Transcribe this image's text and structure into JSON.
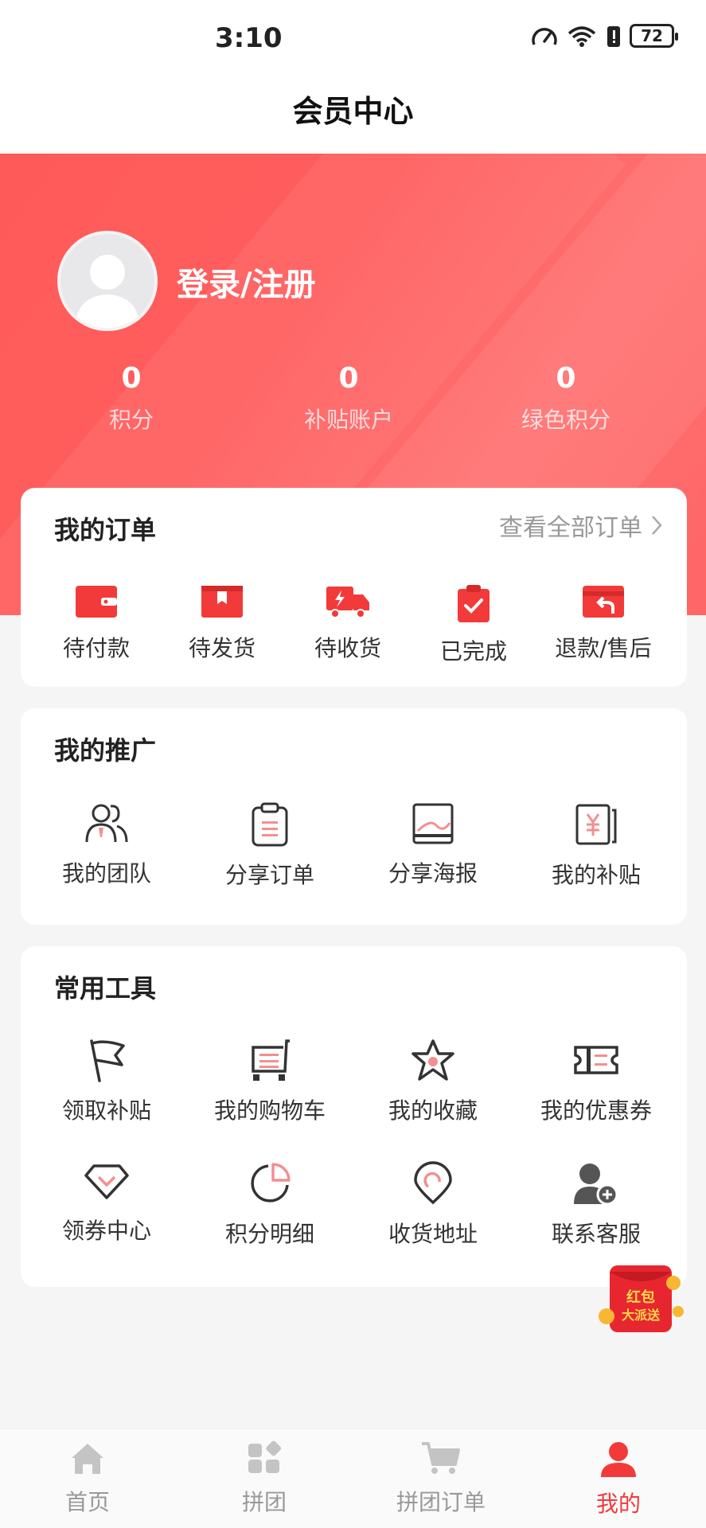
{
  "status_bar": {
    "time": "3:10",
    "battery": "72"
  },
  "header": {
    "title": "会员中心"
  },
  "profile": {
    "login_label": "登录/注册",
    "stats": [
      {
        "value": "0",
        "label": "积分"
      },
      {
        "value": "0",
        "label": "补贴账户"
      },
      {
        "value": "0",
        "label": "绿色积分"
      }
    ]
  },
  "orders": {
    "title": "我的订单",
    "view_all": "查看全部订单",
    "items": [
      {
        "label": "待付款",
        "icon": "wallet-icon"
      },
      {
        "label": "待发货",
        "icon": "box-icon"
      },
      {
        "label": "待收货",
        "icon": "truck-icon"
      },
      {
        "label": "已完成",
        "icon": "clipboard-check-icon"
      },
      {
        "label": "退款/售后",
        "icon": "refund-icon"
      }
    ]
  },
  "promotion": {
    "title": "我的推广",
    "items": [
      {
        "label": "我的团队",
        "icon": "team-icon"
      },
      {
        "label": "分享订单",
        "icon": "clipboard-icon"
      },
      {
        "label": "分享海报",
        "icon": "poster-icon"
      },
      {
        "label": "我的补贴",
        "icon": "subsidy-icon"
      }
    ]
  },
  "tools": {
    "title": "常用工具",
    "items": [
      {
        "label": "领取补贴",
        "icon": "flag-icon"
      },
      {
        "label": "我的购物车",
        "icon": "cart-icon"
      },
      {
        "label": "我的收藏",
        "icon": "star-icon"
      },
      {
        "label": "我的优惠券",
        "icon": "ticket-icon"
      },
      {
        "label": "领券中心",
        "icon": "diamond-icon"
      },
      {
        "label": "积分明细",
        "icon": "pie-icon"
      },
      {
        "label": "收货地址",
        "icon": "location-icon"
      },
      {
        "label": "联系客服",
        "icon": "add-user-icon"
      }
    ]
  },
  "floating": {
    "hongbao_text_1": "红包",
    "hongbao_text_2": "大派送"
  },
  "tabbar": {
    "items": [
      {
        "label": "首页",
        "icon": "home-icon"
      },
      {
        "label": "拼团",
        "icon": "grid-icon"
      },
      {
        "label": "拼团订单",
        "icon": "cart-icon"
      },
      {
        "label": "我的",
        "icon": "user-icon"
      }
    ],
    "active": "我的"
  },
  "colors": {
    "accent": "#f23a3a",
    "hero": "#ff5e5e",
    "icon_pink": "#f48f8f"
  }
}
